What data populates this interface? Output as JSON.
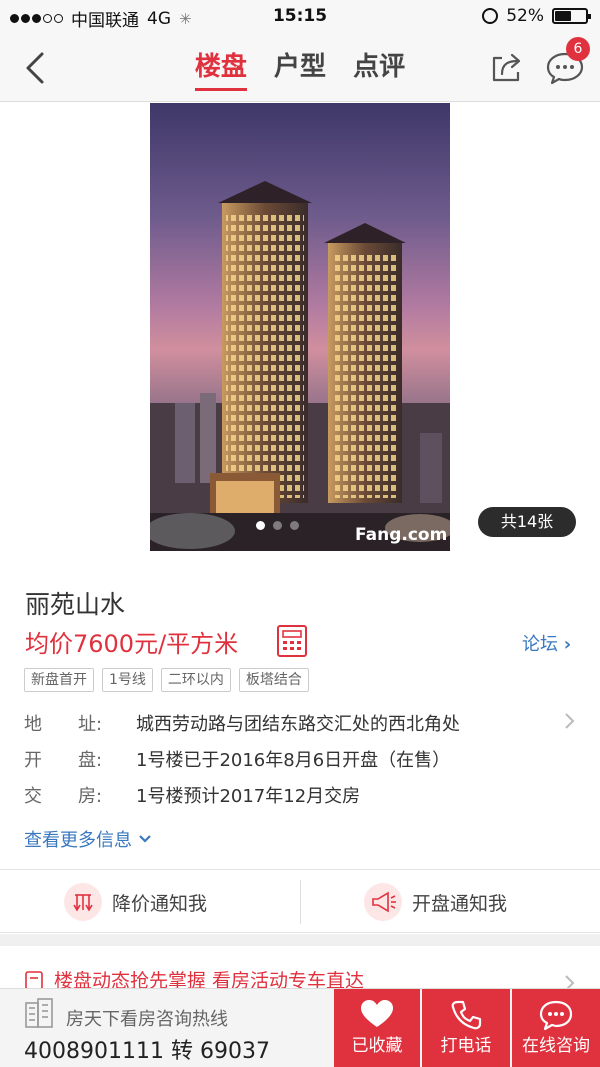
{
  "status_bar": {
    "carrier": "中国联通",
    "network": "4G",
    "time": "15:15",
    "battery": "52%",
    "battery_level": 0.52
  },
  "nav": {
    "tabs": [
      "楼盘",
      "户型",
      "点评"
    ],
    "active_tab": 0,
    "message_badge": "6"
  },
  "gallery": {
    "photo_count": "共14张",
    "current_index": 0,
    "watermark": "Fang.com"
  },
  "project": {
    "name": "丽苑山水",
    "price": "均价7600元/平方米",
    "forum_label": "论坛",
    "tags": [
      "新盘首开",
      "1号线",
      "二环以内",
      "板塔结合"
    ],
    "info": [
      {
        "key": "地　　址:",
        "value": "城西劳动路与团结东路交汇处的西北角处"
      },
      {
        "key": "开　　盘:",
        "value": "1号楼已于2016年8月6日开盘（在售）"
      },
      {
        "key": "交　　房:",
        "value": "1号楼预计2017年12月交房"
      }
    ],
    "more_info": "查看更多信息"
  },
  "notify": {
    "price_drop": "降价通知我",
    "opening": "开盘通知我"
  },
  "news": {
    "text": "楼盘动态抢先掌握  看房活动专车直达"
  },
  "bottom": {
    "hotline_label": "房天下看房咨询热线",
    "hotline_number": "4008901111 转 69037",
    "favorite": "已收藏",
    "call": "打电话",
    "consult": "在线咨询"
  },
  "colors": {
    "accent": "#e0323e",
    "link": "#3a78bf"
  }
}
